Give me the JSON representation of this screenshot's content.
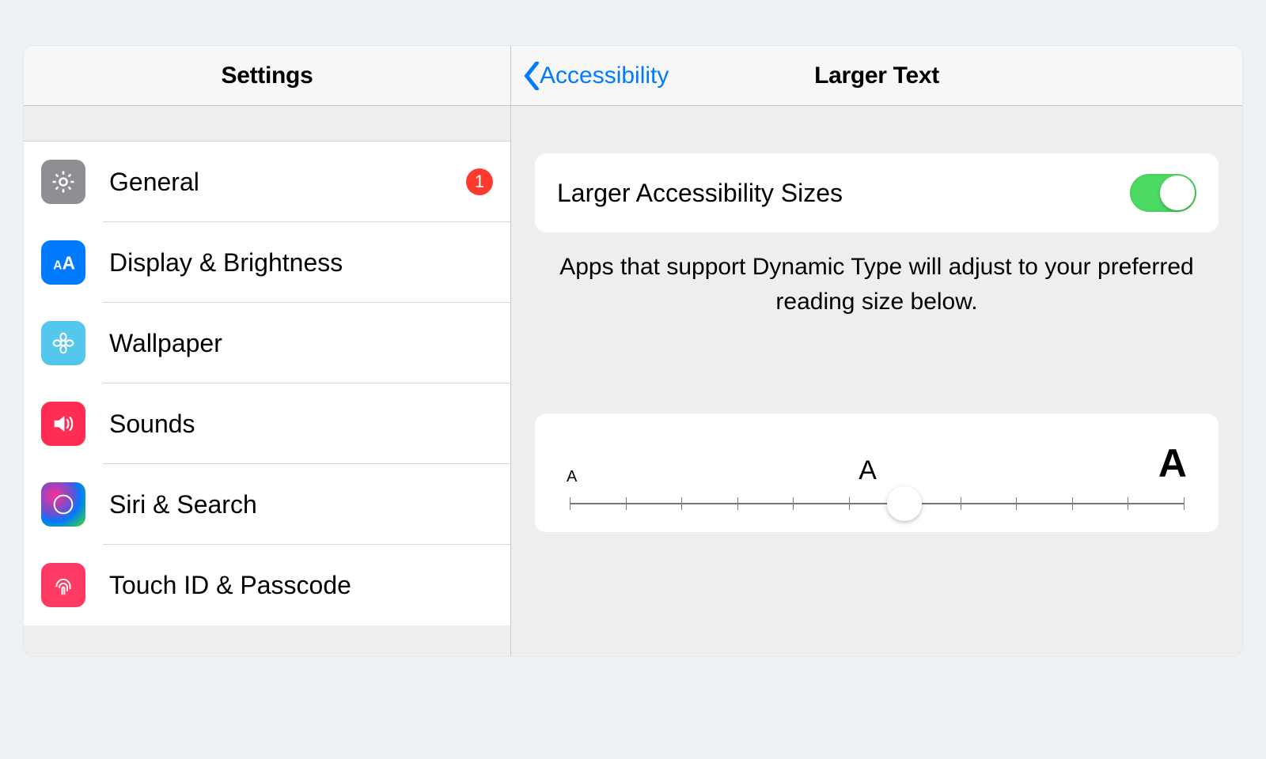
{
  "sidebar": {
    "title": "Settings",
    "items": [
      {
        "label": "General",
        "icon": "gear-icon",
        "badge": "1"
      },
      {
        "label": "Display & Brightness",
        "icon": "text-size-icon"
      },
      {
        "label": "Wallpaper",
        "icon": "flower-icon"
      },
      {
        "label": "Sounds",
        "icon": "speaker-icon"
      },
      {
        "label": "Siri & Search",
        "icon": "siri-icon"
      },
      {
        "label": "Touch ID & Passcode",
        "icon": "fingerprint-icon"
      }
    ]
  },
  "detail": {
    "back_label": "Accessibility",
    "title": "Larger Text",
    "toggle": {
      "label": "Larger Accessibility Sizes",
      "on": true
    },
    "caption": "Apps that support Dynamic Type will adjust to your preferred reading size below.",
    "slider": {
      "min_glyph": "A",
      "mid_glyph": "A",
      "max_glyph": "A",
      "steps": 12,
      "value_index": 6
    }
  },
  "colors": {
    "link": "#007aff",
    "badge": "#ff3b30",
    "switch_on": "#4cd964"
  }
}
